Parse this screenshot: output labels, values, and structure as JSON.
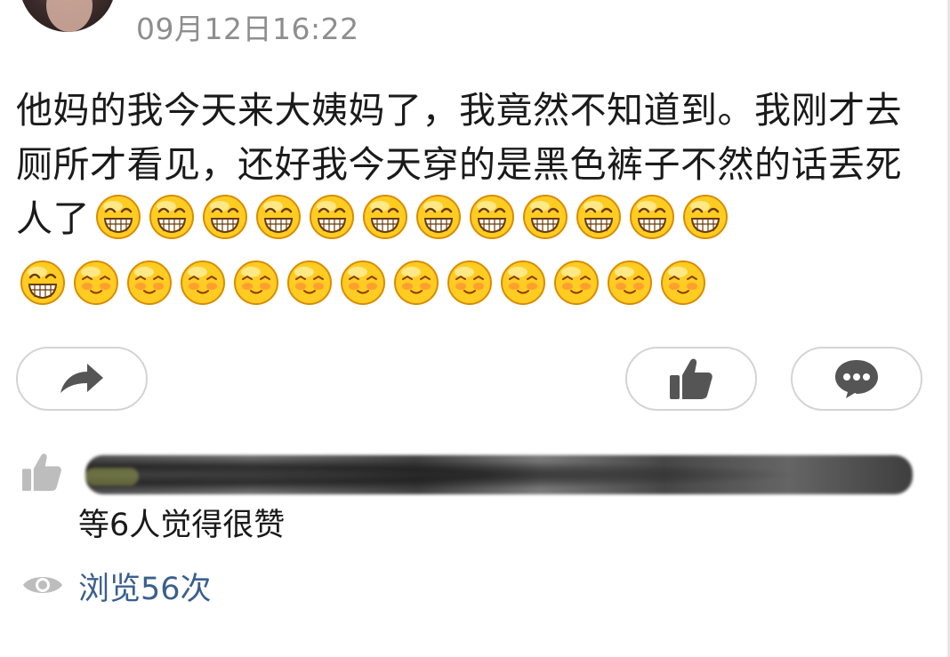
{
  "post": {
    "timestamp": "09月12日16:22",
    "text": "他妈的我今天来大姨妈了，我竟然不知道到。我刚才去厕所才看见，还好我今天穿的是黑色裤子不然的话丢死人了",
    "inline_emojis": [
      "grin-emoji",
      "grin-emoji",
      "grin-emoji",
      "grin-emoji",
      "grin-emoji",
      "grin-emoji",
      "grin-emoji",
      "grin-emoji",
      "grin-emoji",
      "grin-emoji",
      "grin-emoji",
      "grin-emoji"
    ],
    "row_emojis": [
      "grin-emoji",
      "shy-emoji",
      "shy-emoji",
      "shy-emoji",
      "shy-emoji",
      "shy-emoji",
      "shy-emoji",
      "shy-emoji",
      "shy-emoji",
      "shy-emoji",
      "shy-emoji",
      "shy-emoji",
      "shy-emoji"
    ]
  },
  "actions": {
    "share_icon": "share-arrow-icon",
    "like_icon": "thumbs-up-icon",
    "comment_icon": "comment-bubble-icon"
  },
  "likes": {
    "icon": "thumbs-up-icon",
    "summary": "等6人觉得很赞"
  },
  "views": {
    "icon": "eye-icon",
    "label": "浏览56次"
  },
  "colors": {
    "timestamp": "#8e8e8e",
    "views_link": "#3a5f8f",
    "icon_gray": "#bdbdbd",
    "action_icon": "#555555",
    "emoji_yellow": "#ffcc22"
  }
}
